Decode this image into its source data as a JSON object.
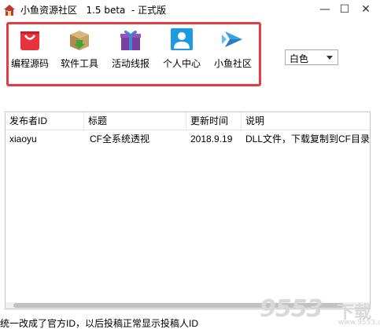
{
  "window": {
    "title": "小鱼资源社区   1.5 beta  - 正式版",
    "minimize_glyph": "—",
    "maximize_glyph": "☐",
    "close_glyph": "✕"
  },
  "toolbar": {
    "items": [
      {
        "label": "编程源码",
        "icon": "red-shopping-bag-icon"
      },
      {
        "label": "软件工具",
        "icon": "software-box-icon"
      },
      {
        "label": "活动线报",
        "icon": "gift-box-icon"
      },
      {
        "label": "个人中心",
        "icon": "user-profile-icon"
      },
      {
        "label": "小鱼社区",
        "icon": "fish-icon"
      }
    ],
    "frame_color": "#e63b42"
  },
  "skin_select": {
    "value": "白色"
  },
  "table": {
    "columns": [
      "发布者ID",
      "标题",
      "更新时间",
      "说明"
    ],
    "rows": [
      [
        "xiaoyu",
        "CF全系统透视",
        "2018.9.19",
        "DLL文件，下载复制到CF目录"
      ]
    ]
  },
  "status": {
    "text": "统一改成了官方ID，以后投稿正常显示投稿人ID"
  },
  "watermark": {
    "number": "9553",
    "suffix": "下载",
    "site": "www.9553.com"
  }
}
